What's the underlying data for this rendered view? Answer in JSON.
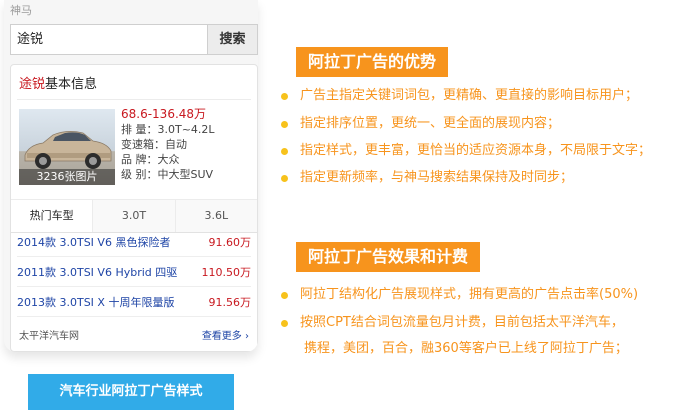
{
  "phone": {
    "brand": "神马",
    "search": {
      "value": "途锐",
      "button_label": "搜索"
    },
    "card": {
      "title_emphasis": "途锐",
      "title_rest": "基本信息",
      "photo_count": "3236张图片",
      "price": "68.6-136.48万",
      "specs": [
        {
          "label": "排    量：",
          "value": "3.0T~4.2L"
        },
        {
          "label": "变速箱：",
          "value": "自动"
        },
        {
          "label": "品    牌：",
          "value": "大众"
        },
        {
          "label": "级    别：",
          "value": "中大型SUV"
        }
      ],
      "tabs": [
        "热门车型",
        "3.0T",
        "3.6L"
      ],
      "models": [
        {
          "name": "2014款 3.0TSI V6 黑色探险者",
          "price": "91.60万"
        },
        {
          "name": "2011款 3.0TSI V6 Hybrid 四驱",
          "price": "110.50万"
        },
        {
          "name": "2013款 3.0TSI X 十周年限量版",
          "price": "91.56万"
        }
      ],
      "source": "太平洋汽车网",
      "more": "查看更多 ›"
    },
    "caption": "汽车行业阿拉丁广告样式"
  },
  "advantages": {
    "heading": "阿拉丁广告的优势",
    "items": [
      "广告主指定关键词词包，更精确、更直接的影响目标用户；",
      "指定排序位置，更统一、更全面的展现内容；",
      "指定样式，更丰富，更恰当的适应资源本身，不局限于文字；",
      "指定更新频率，与神马搜索结果保持及时同步；"
    ]
  },
  "effects": {
    "heading": "阿拉丁广告效果和计费",
    "items": [
      "阿拉丁结构化广告展现样式，拥有更高的广告点击率(50%)",
      "按照CPT结合词包流量包月计费，目前包括太平洋汽车，",
      "携程，美团，百合，融360等客户已上线了阿拉丁广告；"
    ]
  },
  "colors": {
    "accent": "#f7941d",
    "bullet": "#f7c21c",
    "price": "#c8181f",
    "link": "#1f45a6",
    "caption_bar": "#31abe8"
  }
}
